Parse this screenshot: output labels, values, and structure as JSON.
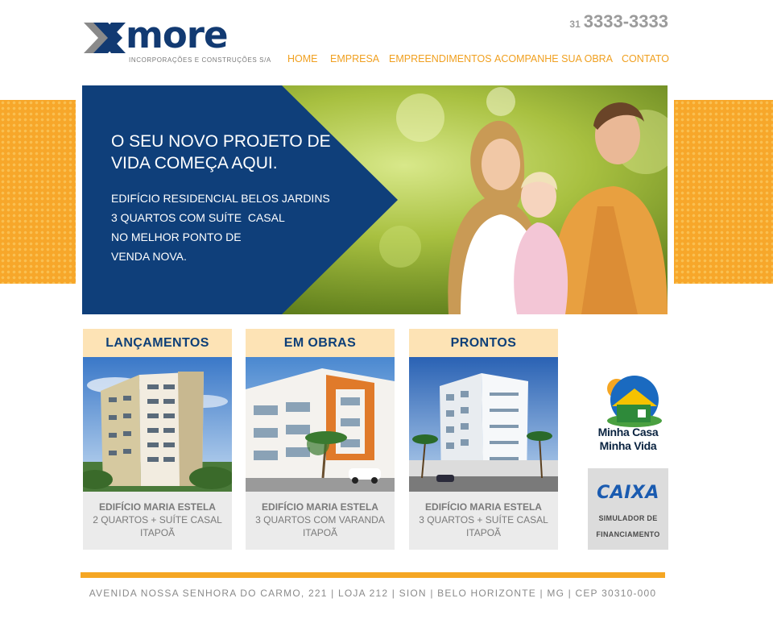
{
  "brand": {
    "name": "more",
    "tagline": "INCORPORAÇÕES E CONSTRUÇÕES S/A"
  },
  "phone": {
    "area_code": "31",
    "number": "3333-3333"
  },
  "nav": [
    {
      "label": "HOME"
    },
    {
      "label": "EMPRESA"
    },
    {
      "label": "EMPREENDIMENTOS"
    },
    {
      "label": "ACOMPANHE SUA OBRA"
    },
    {
      "label": "CONTATO"
    }
  ],
  "hero": {
    "headline": "O SEU NOVO PROJETO DE VIDA COMEÇA AQUI.",
    "lines": [
      "EDIFÍCIO RESIDENCIAL BELOS JARDINS",
      "3 QUARTOS COM SUÍTE  CASAL",
      "NO MELHOR PONTO DE",
      "VENDA NOVA."
    ]
  },
  "cards": [
    {
      "title": "LANÇAMENTOS",
      "name": "EDIFÍCIO MARIA ESTELA",
      "detail": "2 QUARTOS + SUÍTE CASAL",
      "location": "ITAPOÃ"
    },
    {
      "title": "EM OBRAS",
      "name": "EDIFÍCIO MARIA ESTELA",
      "detail": "3 QUARTOS COM VARANDA",
      "location": "ITAPOÃ"
    },
    {
      "title": "PRONTOS",
      "name": "EDIFÍCIO MARIA ESTELA",
      "detail": "3 QUARTOS + SUÍTE CASAL",
      "location": "ITAPOÃ"
    }
  ],
  "mcmv": {
    "line1": "Minha Casa",
    "line2": "Minha Vida"
  },
  "caixa": {
    "logo": "CAIXA",
    "line1": "SIMULADOR DE",
    "line2": "FINANCIAMENTO"
  },
  "footer": {
    "address": "AVENIDA NOSSA SENHORA DO CARMO, 221 | LOJA 212 | SION | BELO HORIZONTE | MG | CEP 30310-000"
  },
  "colors": {
    "brand_blue": "#123a72",
    "nav_orange": "#f0a020",
    "accent_orange": "#f5a623",
    "card_head_bg": "#fde3b5"
  },
  "icons": [
    "brand-logo-mark-icon",
    "house-sun-icon"
  ]
}
